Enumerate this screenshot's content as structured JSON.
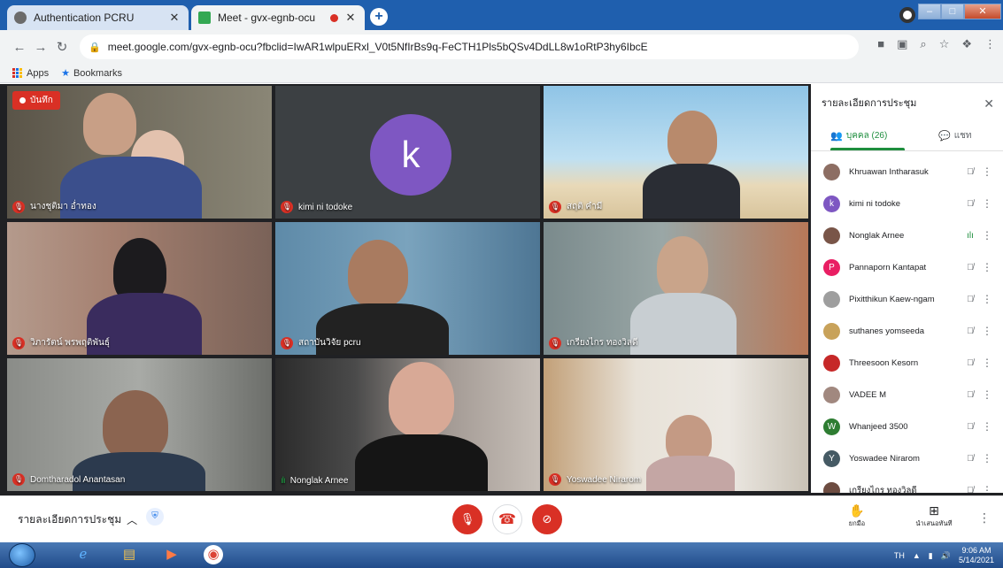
{
  "browser": {
    "tabs": [
      {
        "title": "Authentication PCRU",
        "favicon_color": "#6b6b6b"
      },
      {
        "title": "Meet - gvx-egnb-ocu",
        "favicon_color": "#34a853"
      }
    ],
    "url": "meet.google.com/gvx-egnb-ocu?fbclid=IwAR1wlpuERxl_V0t5NfIrBs9q-FeCTH1Pls5bQSv4DdLL8w1oRtP3hy6IbcE",
    "bookmarks": {
      "apps": "Apps",
      "bookmarks": "Bookmarks"
    }
  },
  "meet": {
    "recording_label": "บันทึก",
    "tiles": [
      {
        "name": "นางชุติมา อ่ำทอง",
        "mic": "off"
      },
      {
        "name": "kimi ni todoke",
        "mic": "off",
        "avatar_letter": "k"
      },
      {
        "name": "สฤติ คำมี",
        "mic": "off"
      },
      {
        "name": "วิภารัตน์ พรพฤติพันธุ์",
        "mic": "off"
      },
      {
        "name": "สถาบันวิจัย pcru",
        "mic": "off"
      },
      {
        "name": "เกรียงไกร ทองวิลดี",
        "mic": "off"
      },
      {
        "name": "Domtharadol Anantasan",
        "mic": "off"
      },
      {
        "name": "Nonglak Arnee",
        "mic": "speaking"
      },
      {
        "name": "Yoswadee Nirarom",
        "mic": "off"
      }
    ],
    "panel": {
      "title": "รายละเอียดการประชุม",
      "tab_people": "บุคคล (26)",
      "tab_chat": "แชท",
      "participants": [
        {
          "name": "Khruawan Intharasuk",
          "avatar_color": "#8d6e63",
          "avatar_letter": "",
          "mic": "off"
        },
        {
          "name": "kimi ni todoke",
          "avatar_color": "#7e57c2",
          "avatar_letter": "k",
          "mic": "off"
        },
        {
          "name": "Nonglak Arnee",
          "avatar_color": "#795548",
          "avatar_letter": "",
          "mic": "on"
        },
        {
          "name": "Pannaporn Kantapat",
          "avatar_color": "#e91e63",
          "avatar_letter": "P",
          "mic": "off"
        },
        {
          "name": "Pixitthikun Kaew-ngam",
          "avatar_color": "#9e9e9e",
          "avatar_letter": "",
          "mic": "off"
        },
        {
          "name": "suthanes yomseeda",
          "avatar_color": "#c8a25a",
          "avatar_letter": "",
          "mic": "off"
        },
        {
          "name": "Threesoon Kesorn",
          "avatar_color": "#c62828",
          "avatar_letter": "",
          "mic": "off"
        },
        {
          "name": "VADEE M",
          "avatar_color": "#a1887f",
          "avatar_letter": "",
          "mic": "off"
        },
        {
          "name": "Whanjeed 3500",
          "avatar_color": "#2e7d32",
          "avatar_letter": "W",
          "mic": "off"
        },
        {
          "name": "Yoswadee Nirarom",
          "avatar_color": "#455a64",
          "avatar_letter": "Y",
          "mic": "off"
        },
        {
          "name": "เกรียงไกร ทองวิลดี",
          "avatar_color": "#6d4c41",
          "avatar_letter": "",
          "mic": "off"
        }
      ]
    },
    "controls": {
      "meeting_details": "รายละเอียดการประชุม",
      "raise_hand": "ยกมือ",
      "present_now": "นำเสนอทันที"
    }
  },
  "taskbar": {
    "lang": "TH",
    "time": "9:06 AM",
    "date": "5/14/2021"
  },
  "colors": {
    "meet_bg": "#202124",
    "mic_off_red": "#d93025",
    "meet_green": "#1e8e3e",
    "tabstrip_blue": "#1f5fae"
  }
}
